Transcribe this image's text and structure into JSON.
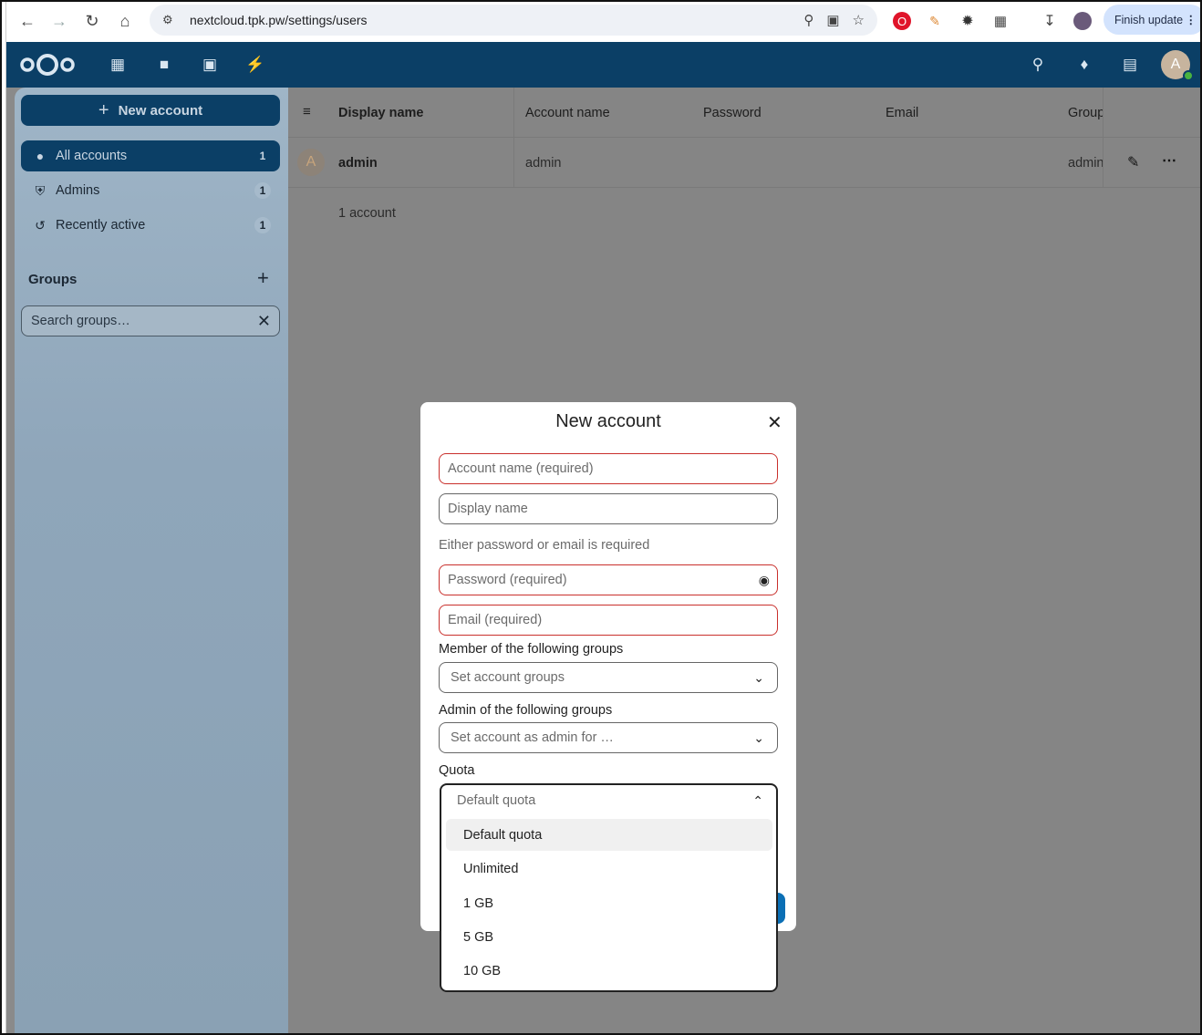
{
  "browser": {
    "url": "nextcloud.tpk.pw/settings/users",
    "finish_update": "Finish update"
  },
  "sidebar": {
    "new_account": "New account",
    "items": [
      {
        "label": "All accounts",
        "count": "1"
      },
      {
        "label": "Admins",
        "count": "1"
      },
      {
        "label": "Recently active",
        "count": "1"
      }
    ],
    "groups_title": "Groups",
    "search_placeholder": "Search groups…"
  },
  "table": {
    "headers": [
      "Display name",
      "Account name",
      "Password",
      "Email",
      "Group"
    ],
    "rows": [
      {
        "avatar": "A",
        "display_name": "admin",
        "account_name": "admin",
        "group": "admin"
      }
    ],
    "count_label": "1 account"
  },
  "header": {
    "avatar_letter": "A"
  },
  "modal": {
    "title": "New account",
    "account_name_placeholder": "Account name (required)",
    "display_name_placeholder": "Display name",
    "hint": "Either password or email is required",
    "password_placeholder": "Password (required)",
    "email_placeholder": "Email (required)",
    "member_label": "Member of the following groups",
    "member_placeholder": "Set account groups",
    "admin_label": "Admin of the following groups",
    "admin_placeholder": "Set account as admin for …",
    "quota_label": "Quota",
    "quota_selected": "Default quota",
    "quota_options": [
      "Default quota",
      "Unlimited",
      "1 GB",
      "5 GB",
      "10 GB"
    ]
  },
  "colors": {
    "brand": "#0b3f66",
    "error_border": "#c9302c"
  }
}
